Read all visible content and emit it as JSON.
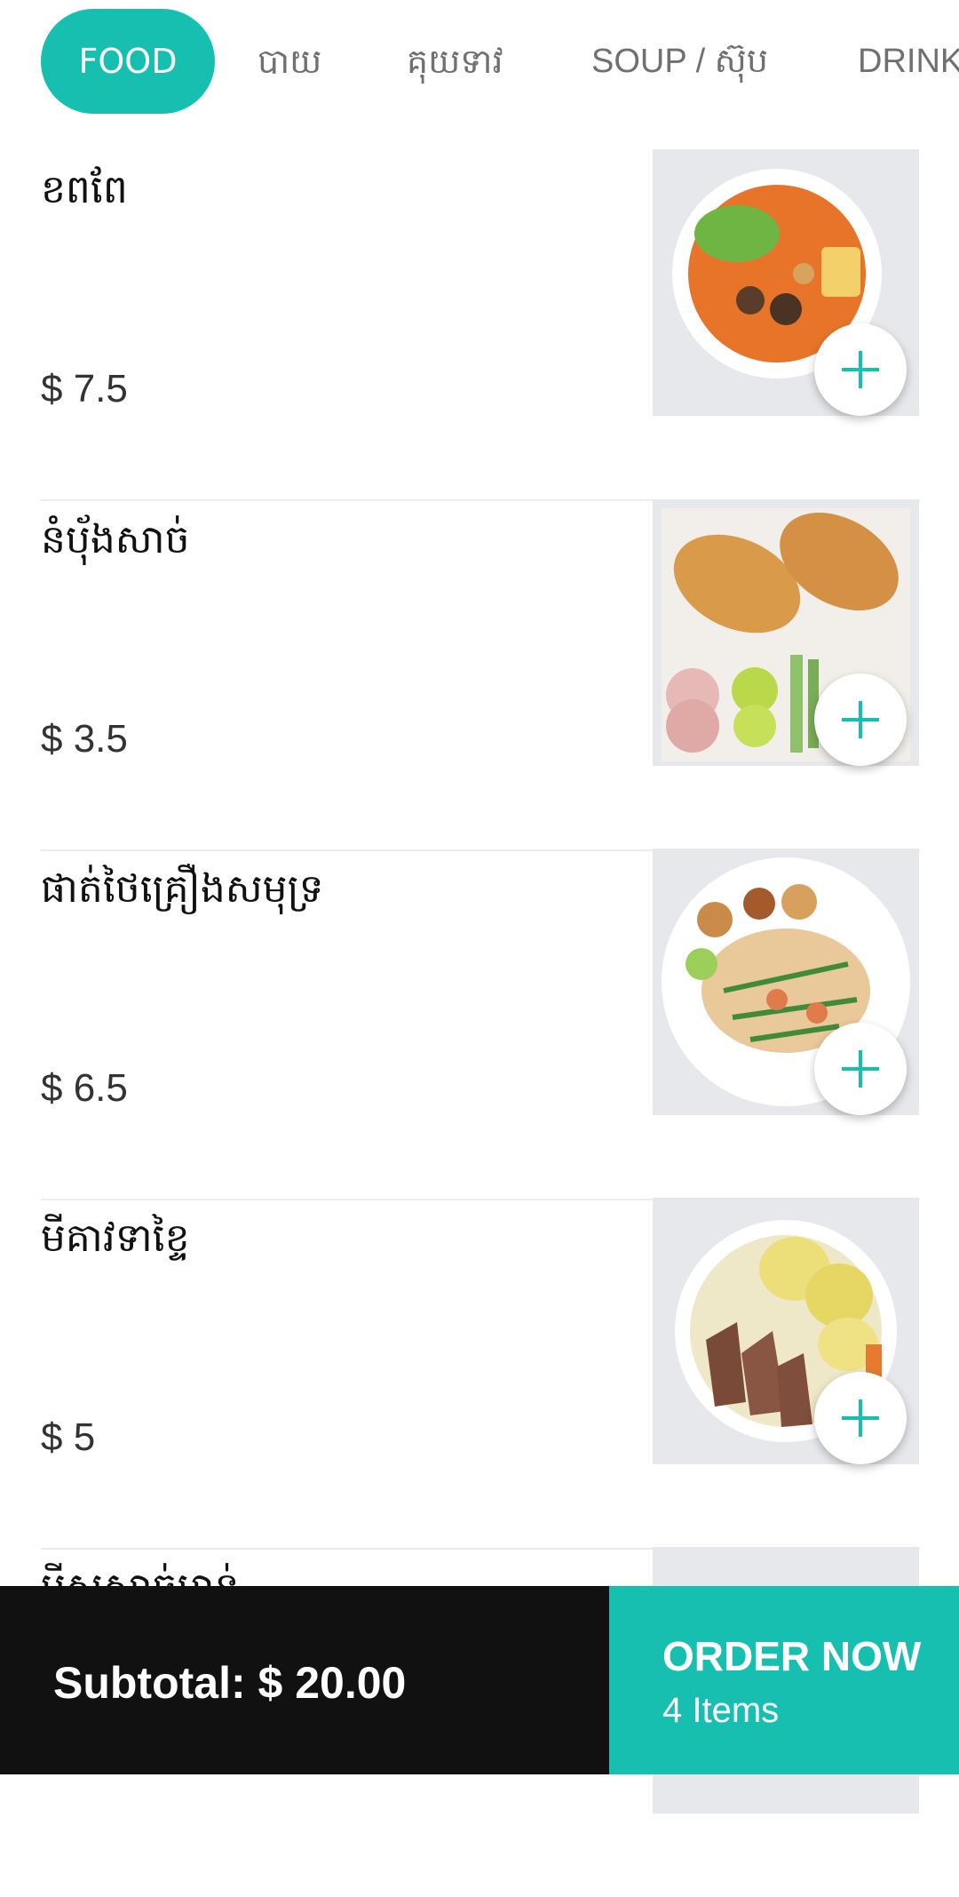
{
  "tabs": [
    {
      "label": "FOOD",
      "active": true
    },
    {
      "label": "បាយ",
      "active": false
    },
    {
      "label": "គុយទាវ",
      "active": false
    },
    {
      "label": "SOUP / ស៊ុប",
      "active": false
    },
    {
      "label": "DRINK",
      "active": false
    }
  ],
  "items": [
    {
      "name": "ខពពែ",
      "price": "$ 7.5",
      "image": "curry-bowl"
    },
    {
      "name": "នំប៉័ងសាច់",
      "price": "$ 3.5",
      "image": "baguette-plate"
    },
    {
      "name": "ផាត់ថៃគ្រឿងសមុទ្រ",
      "price": "$ 6.5",
      "image": "pad-thai-plate"
    },
    {
      "name": "មីគាវទាខ្ទៃ",
      "price": "$ 5",
      "image": "wonton-duck-noodle"
    },
    {
      "name": "មីសួសាច់មាន់",
      "price": "",
      "image": "partial-dish"
    }
  ],
  "footer": {
    "subtotal": "Subtotal:  $ 20.00",
    "order_label": "ORDER NOW",
    "item_count": "4 Items"
  },
  "colors": {
    "accent": "#17bfb0",
    "footer_dark": "#111111",
    "divider": "#ececec"
  },
  "icons": {
    "add": "plus-icon"
  }
}
